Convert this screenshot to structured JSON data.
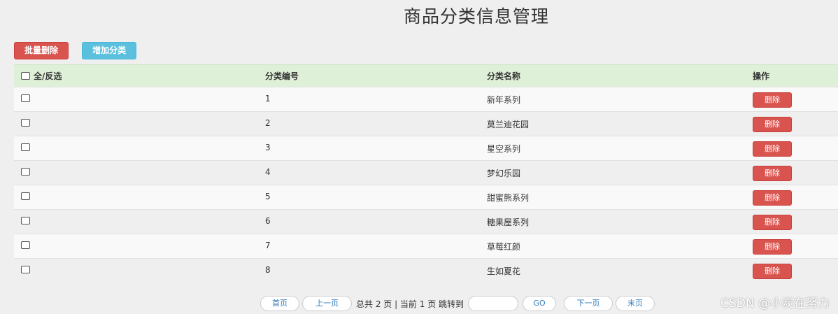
{
  "page": {
    "title": "商品分类信息管理"
  },
  "toolbar": {
    "batch_delete_label": "批量删除",
    "add_category_label": "增加分类"
  },
  "table": {
    "headers": {
      "select_all": "全/反选",
      "category_id": "分类编号",
      "category_name": "分类名称",
      "actions": "操作"
    },
    "delete_label": "删除",
    "rows": [
      {
        "id": "1",
        "name": "新年系列"
      },
      {
        "id": "2",
        "name": "莫兰迪花园"
      },
      {
        "id": "3",
        "name": "星空系列"
      },
      {
        "id": "4",
        "name": "梦幻乐园"
      },
      {
        "id": "5",
        "name": "甜蜜熊系列"
      },
      {
        "id": "6",
        "name": "糖果屋系列"
      },
      {
        "id": "7",
        "name": "草莓红颜"
      },
      {
        "id": "8",
        "name": "生如夏花"
      }
    ]
  },
  "pagination": {
    "first_label": "首页",
    "prev_label": "上一页",
    "info": "总共 2 页 | 当前 1 页 跳转到",
    "go_label": "GO",
    "next_label": "下一页",
    "last_label": "末页",
    "jump_value": ""
  },
  "watermark": {
    "text": "CSDN @小炭在努力"
  },
  "colors": {
    "danger": "#d9534f",
    "info": "#5bc0de",
    "header_bg": "#dff0d8",
    "link": "#337ab7"
  }
}
